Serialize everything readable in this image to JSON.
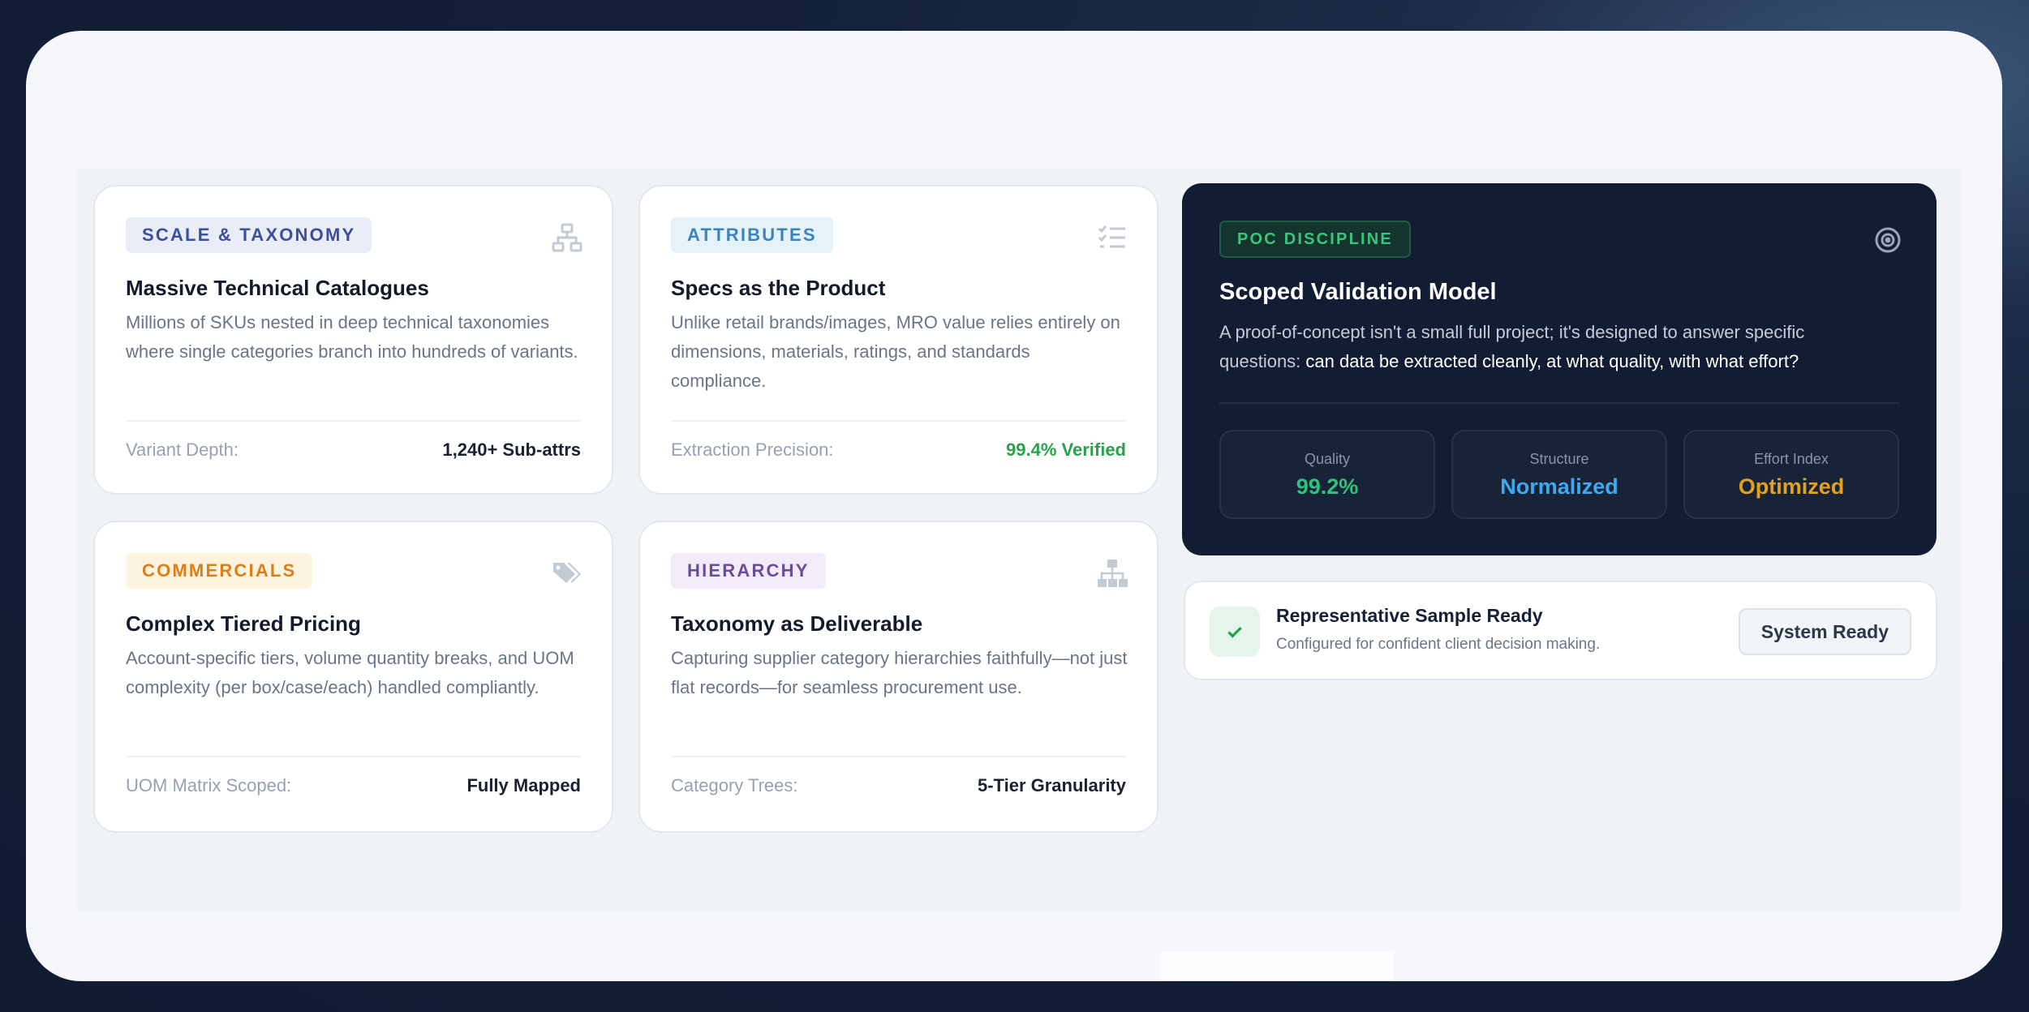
{
  "colors": {
    "page_bg": "#131f38",
    "sheet_bg": "#f5f7fa",
    "dark_panel": "#121c33",
    "accent_green": "#2aa24b",
    "accent_blue": "#3ea9ee",
    "accent_amber": "#e2a21b"
  },
  "cards": [
    {
      "badge": "SCALE & TAXONOMY",
      "icon": "sitemap-icon",
      "title": "Massive Technical Catalogues",
      "description": "Millions of SKUs nested in deep technical taxonomies where single categories branch into hundreds of variants.",
      "footer_label": "Variant Depth:",
      "footer_value": "1,240+ Sub-attrs"
    },
    {
      "badge": "ATTRIBUTES",
      "icon": "checklist-icon",
      "title": "Specs as the Product",
      "description": "Unlike retail brands/images, MRO value relies entirely on dimensions, materials, ratings, and standards compliance.",
      "footer_label": "Extraction Precision:",
      "footer_value": "99.4% Verified"
    },
    {
      "badge": "COMMERCIALS",
      "icon": "tags-icon",
      "title": "Complex Tiered Pricing",
      "description": "Account-specific tiers, volume quantity breaks, and UOM complexity (per box/case/each) handled compliantly.",
      "footer_label": "UOM Matrix Scoped:",
      "footer_value": "Fully Mapped"
    },
    {
      "badge": "HIERARCHY",
      "icon": "hierarchy-icon",
      "title": "Taxonomy as Deliverable",
      "description": "Capturing supplier category hierarchies faithfully—not just flat records—for seamless procurement use.",
      "footer_label": "Category Trees:",
      "footer_value": "5-Tier Granularity"
    }
  ],
  "poc": {
    "badge": "POC DISCIPLINE",
    "icon": "target-icon",
    "title": "Scoped Validation Model",
    "description_lead": "A proof-of-concept isn't a small full project; it's designed to answer specific questions: ",
    "description_emphasis": "can data be extracted cleanly, at what quality, with what effort?",
    "metrics": [
      {
        "label": "Quality",
        "value": "99.2%",
        "color": "#2ec27e"
      },
      {
        "label": "Structure",
        "value": "Normalized",
        "color": "#3ea9ee"
      },
      {
        "label": "Effort Index",
        "value": "Optimized",
        "color": "#e2a21b"
      }
    ]
  },
  "status": {
    "icon": "check-icon",
    "title": "Representative Sample Ready",
    "subtitle": "Configured for confident client decision making.",
    "button": "System Ready"
  }
}
